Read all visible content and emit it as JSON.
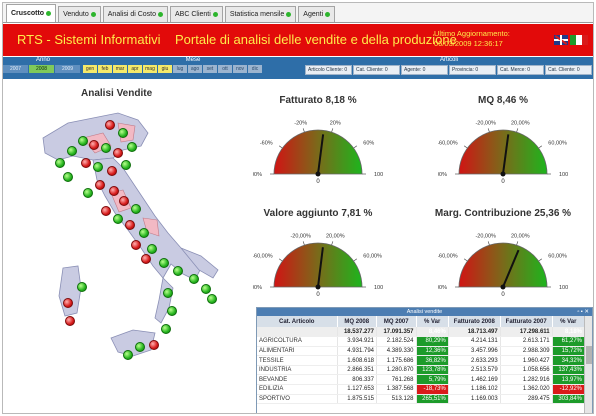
{
  "tabs": [
    {
      "label": "Cruscotto",
      "active": true
    },
    {
      "label": "Venduto",
      "active": false
    },
    {
      "label": "Analisi di Costo",
      "active": false
    },
    {
      "label": "ABC Clienti",
      "active": false
    },
    {
      "label": "Statistica mensile",
      "active": false
    },
    {
      "label": "Agenti",
      "active": false
    }
  ],
  "header": {
    "brand": "RTS - Sistemi Informativi",
    "subtitle": "Portale di analisi delle vendite e della produzione",
    "update_label": "Ultimo Aggiornamento:",
    "update_value": "06/03/2009 12:36:17",
    "background": "#e20a0a",
    "text_color": "#ffeb4a"
  },
  "filters": {
    "anno_label": "Anno",
    "mese_label": "Mese",
    "articoli_label": "Articoli",
    "years": [
      {
        "label": "2007",
        "selected": false
      },
      {
        "label": "2008",
        "selected": true
      },
      {
        "label": "2009",
        "selected": false
      }
    ],
    "months": [
      {
        "label": "gen",
        "on": true
      },
      {
        "label": "feb",
        "on": true
      },
      {
        "label": "mar",
        "on": true
      },
      {
        "label": "apr",
        "on": true
      },
      {
        "label": "mag",
        "on": true
      },
      {
        "label": "giu",
        "on": true
      },
      {
        "label": "lug",
        "on": false
      },
      {
        "label": "ago",
        "on": false
      },
      {
        "label": "set",
        "on": false
      },
      {
        "label": "ott",
        "on": false
      },
      {
        "label": "nov",
        "on": false
      },
      {
        "label": "dic",
        "on": false
      }
    ],
    "dropdowns": [
      "Articolo Cliente: 0",
      "Cat. Cliente: 0",
      "Agente: 0",
      "Provincia: 0",
      "Cat. Merce: 0",
      "Cat. Cliente: 0"
    ]
  },
  "map": {
    "title": "Analisi Vendite",
    "land_color": "#c9cbe2",
    "sea_color": "#ffffff"
  },
  "gauges": [
    {
      "id": "fatturato",
      "title": "Fatturato 8,18 %",
      "value_pct": 8.18,
      "readout": "0",
      "labels": [
        "-100%",
        "-60%",
        "-20%",
        "20%",
        "60%",
        "100%"
      ]
    },
    {
      "id": "mq",
      "title": "MQ 8,46 %",
      "value_pct": 8.46,
      "readout": "0",
      "labels": [
        "-100,00%",
        "-60,00%",
        "-20,00%",
        "20,00%",
        "60,00%",
        "100,00%"
      ]
    },
    {
      "id": "valore",
      "title": "Valore aggiunto 7,81 %",
      "value_pct": 7.81,
      "readout": "0",
      "labels": [
        "-100,00%",
        "-60,00%",
        "-20,00%",
        "20,00%",
        "60,00%",
        "100,00%"
      ]
    },
    {
      "id": "margine",
      "title": "Marg. Contribuzione 25,36 %",
      "value_pct": 25.36,
      "readout": "0",
      "labels": [
        "-100,00%",
        "-60,00%",
        "-20,00%",
        "20,00%",
        "60,00%",
        "100,00%"
      ]
    }
  ],
  "table": {
    "title": "Analisi vendite",
    "columns": [
      "Cat. Articolo",
      "MQ 2008",
      "MQ 2007",
      "% Var",
      "Fatturato 2008",
      "Fatturato 2007",
      "% Var"
    ],
    "total": [
      "",
      "18.537.277",
      "17.091.357",
      "8,46%",
      "18.713.497",
      "17.298.611",
      "8,18%"
    ],
    "rows": [
      [
        "AGRICOLTURA",
        "3.934.921",
        "2.182.524",
        "80,29%",
        "4.214.131",
        "2.613.171",
        "61,27%"
      ],
      [
        "ALIMENTARI",
        "4.931.794",
        "4.389.330",
        "12,36%",
        "3.457.996",
        "2.988.309",
        "15,72%"
      ],
      [
        "TESSILE",
        "1.608.618",
        "1.175.686",
        "36,82%",
        "2.633.293",
        "1.960.427",
        "34,32%"
      ],
      [
        "INDUSTRIA",
        "2.866.351",
        "1.280.870",
        "123,78%",
        "2.513.579",
        "1.058.656",
        "137,43%"
      ],
      [
        "BEVANDE",
        "806.337",
        "761.268",
        "5,79%",
        "1.462.169",
        "1.282.916",
        "13,97%"
      ],
      [
        "EDILIZIA",
        "1.127.653",
        "1.387.568",
        "-18,73%",
        "1.186.102",
        "1.362.020",
        "-12,92%"
      ],
      [
        "SPORTIVO",
        "1.875.515",
        "513.128",
        "265,51%",
        "1.169.003",
        "289.475",
        "303,84%"
      ]
    ],
    "positive_color": "#1d9b2a",
    "negative_color": "#d91a1a"
  }
}
